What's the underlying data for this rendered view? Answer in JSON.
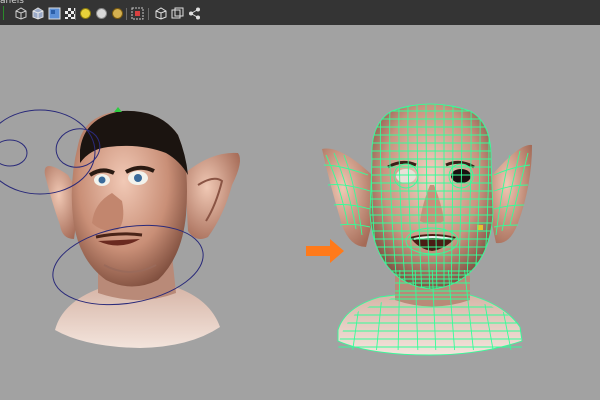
{
  "window": {
    "menu_label": "anels"
  },
  "toolbar": {
    "buttons": [
      {
        "name": "wireframe-cube-icon"
      },
      {
        "name": "smooth-shade-cube-icon"
      },
      {
        "name": "textured-cube-icon"
      },
      {
        "name": "use-default-light-icon"
      },
      {
        "name": "all-lights-icon"
      },
      {
        "name": "selected-lights-icon"
      },
      {
        "name": "isolate-select-icon"
      },
      {
        "name": "xray-icon"
      },
      {
        "name": "wireframe-on-shaded-icon"
      },
      {
        "name": "share-node-icon"
      }
    ]
  },
  "viewport": {
    "background": "#a2a2a2",
    "left_model": "shaded-head-with-controls",
    "right_model": "wireframe-on-shaded-head",
    "arrow_color": "#ff7a1a",
    "wire_color": "#33ff99",
    "skin_color": "#d9a48e",
    "control_curve_color": "#2a2a7a"
  }
}
